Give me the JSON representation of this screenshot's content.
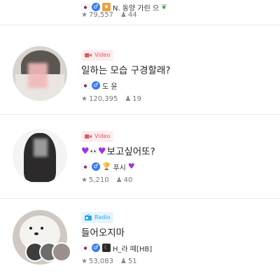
{
  "items": [
    {
      "title": "",
      "meta_text": "N. 동양 가린 으",
      "views": "79,557",
      "members": "44"
    },
    {
      "badge": "Video",
      "title": "일하는 모습 구경할래?",
      "dj": "도 윤",
      "views": "120,395",
      "members": "19"
    },
    {
      "badge": "Video",
      "title": "보고싶어또?",
      "dj": "푸시",
      "views": "5,210",
      "members": "40"
    },
    {
      "badge": "Radio",
      "title": "들어오지마",
      "dj": "H_라 떼[HB]",
      "views": "53,083",
      "members": "51"
    }
  ],
  "colors": {
    "video_badge": "#e35a5a",
    "radio_badge": "#27a5e8",
    "heart": "#9b33e8",
    "stat_text": "#777777"
  },
  "icons": {
    "views": "star-icon",
    "members": "person-icon",
    "video": "video-camera-icon",
    "radio": "radio-icon"
  }
}
